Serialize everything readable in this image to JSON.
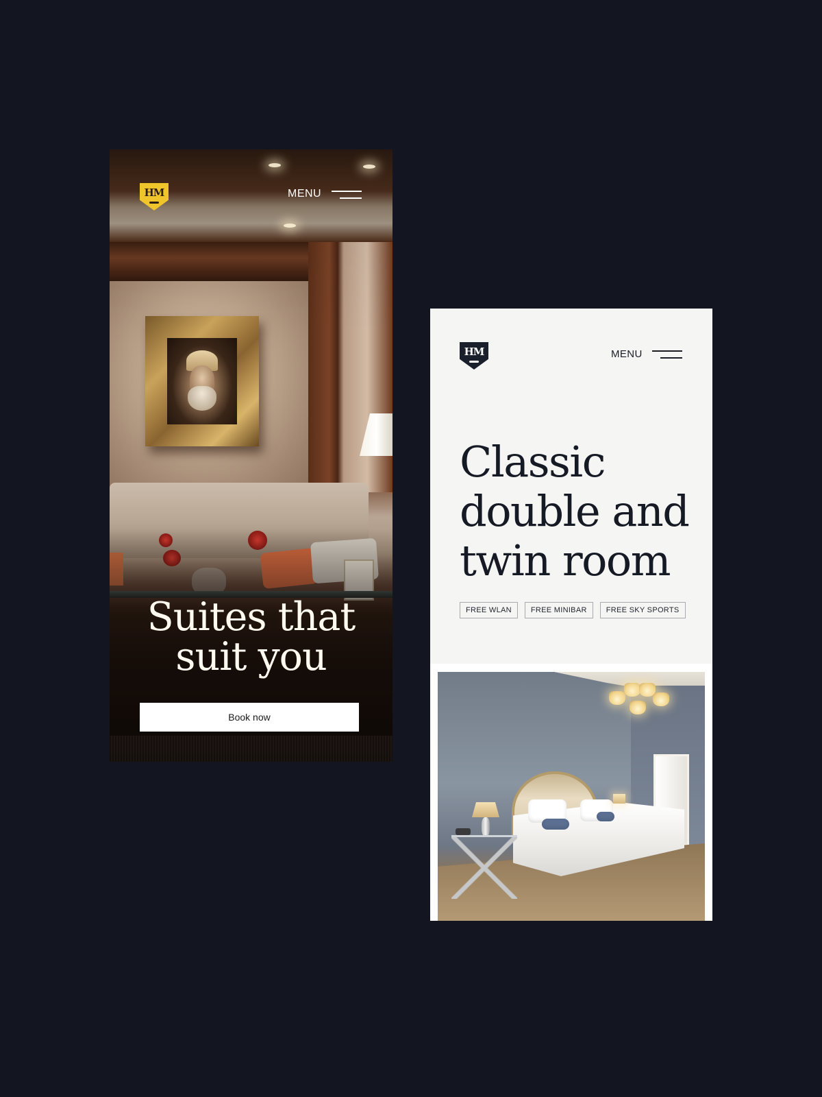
{
  "colors": {
    "page_background": "#131621",
    "logo_gold": "#f0c52c",
    "logo_navy": "#1a1f2c",
    "light_panel": "#f5f5f3",
    "button_white": "#ffffff"
  },
  "screen_left": {
    "logo": {
      "monogram": "HM",
      "icon": "hotel-crest-icon"
    },
    "menu_label": "MENU",
    "menu_icon": "hamburger-icon",
    "hero_title_line1": "Suites that",
    "hero_title_line2": "suit you",
    "book_button_label": "Book now",
    "background_image": "hotel-lounge-photo"
  },
  "screen_right": {
    "logo": {
      "monogram": "HM",
      "icon": "hotel-crest-icon"
    },
    "menu_label": "MENU",
    "menu_icon": "hamburger-icon",
    "title_line1": "Classic",
    "title_line2": "double and",
    "title_line3": "twin room",
    "amenities": [
      "FREE WLAN",
      "FREE MINIBAR",
      "FREE SKY SPORTS"
    ],
    "room_image": "twin-bedroom-photo"
  }
}
